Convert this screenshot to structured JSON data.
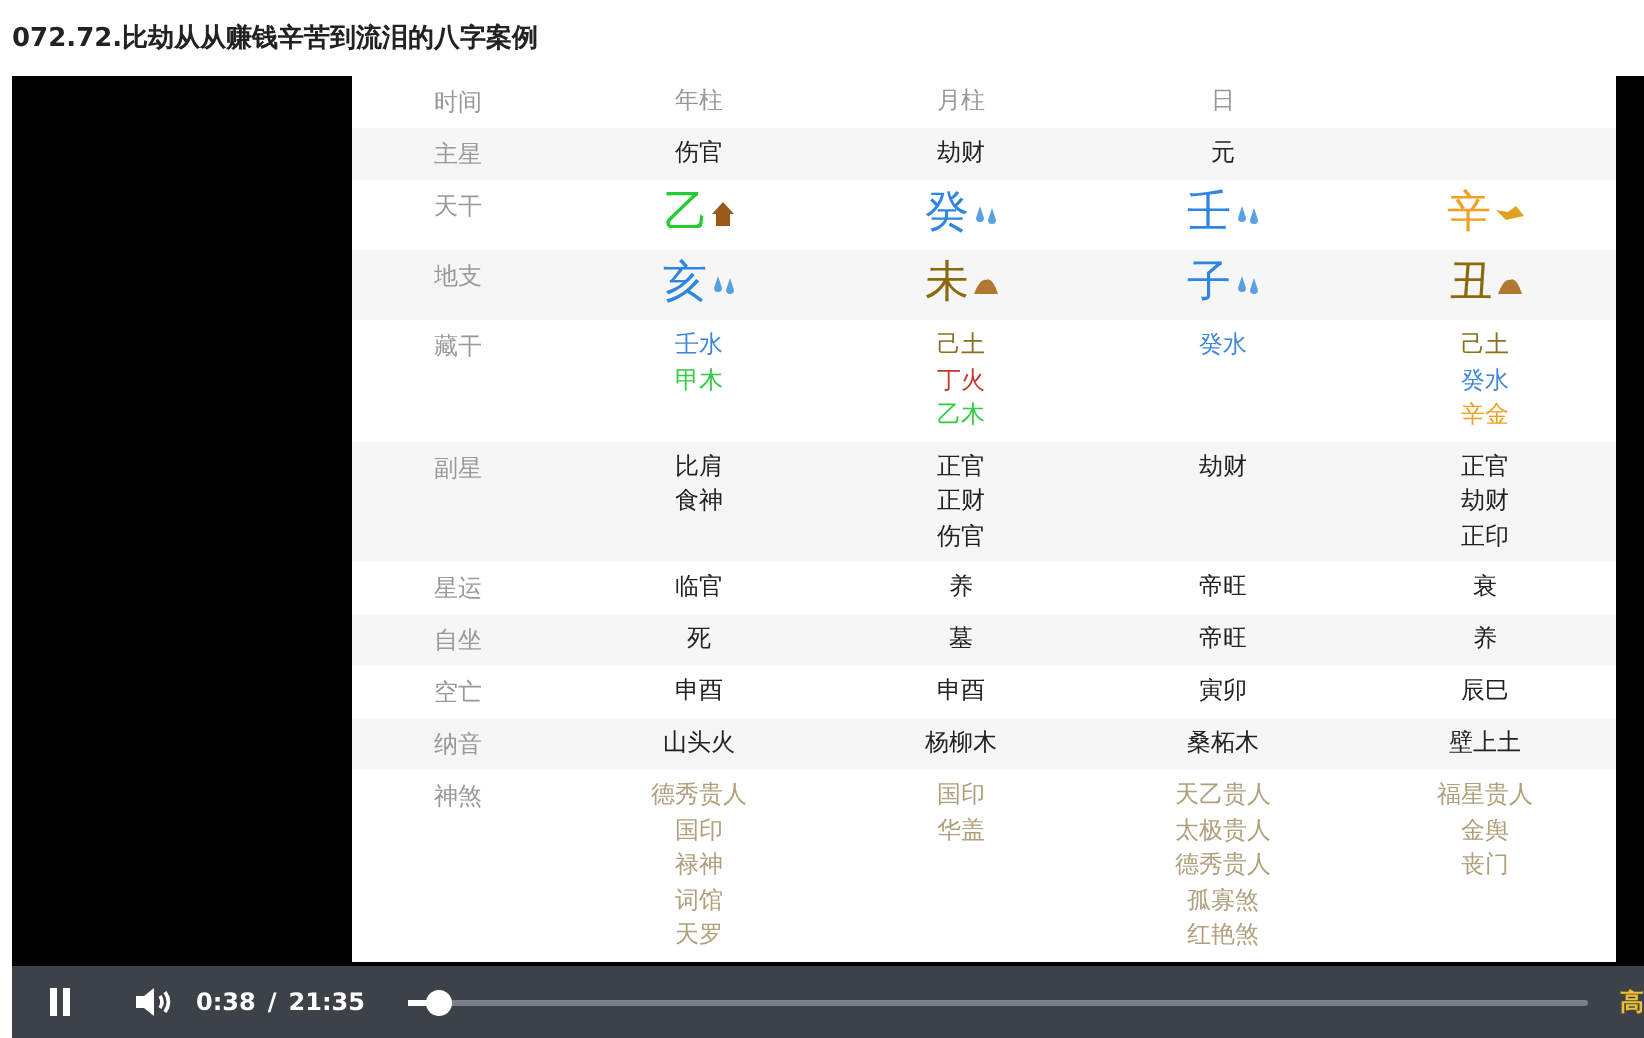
{
  "title": "072.72.比劫从从赚钱辛苦到流泪的八字案例",
  "table": {
    "rows": [
      {
        "label": "时间",
        "kind": "header",
        "cells": [
          [
            {
              "text": "年柱"
            }
          ],
          [
            {
              "text": "月柱"
            }
          ],
          [
            {
              "text": "日"
            }
          ],
          []
        ]
      },
      {
        "label": "主星",
        "kind": "star",
        "cells": [
          [
            {
              "text": "伤官"
            }
          ],
          [
            {
              "text": "劫财"
            }
          ],
          [
            {
              "text": "元"
            }
          ],
          []
        ]
      },
      {
        "label": "天干",
        "kind": "pillar",
        "cells": [
          [
            {
              "text": "乙",
              "color": "#22cc33",
              "kind": "wood"
            }
          ],
          [
            {
              "text": "癸",
              "color": "#2f86e0",
              "kind": "water"
            }
          ],
          [
            {
              "text": "壬",
              "color": "#2f86e0",
              "kind": "water"
            }
          ],
          [
            {
              "text": "辛",
              "color": "#f0a020",
              "kind": "metal"
            }
          ]
        ]
      },
      {
        "label": "地支",
        "kind": "pillar",
        "cells": [
          [
            {
              "text": "亥",
              "color": "#2f86e0",
              "kind": "water"
            }
          ],
          [
            {
              "text": "未",
              "color": "#8a6a10",
              "kind": "earth"
            }
          ],
          [
            {
              "text": "子",
              "color": "#2f86e0",
              "kind": "water"
            }
          ],
          [
            {
              "text": "丑",
              "color": "#8a6a10",
              "kind": "earth"
            }
          ]
        ]
      },
      {
        "label": "藏干",
        "kind": "tone",
        "cells": [
          [
            {
              "text": "壬水",
              "color": "#3f88d8"
            },
            {
              "text": "甲木",
              "color": "#33cc44"
            }
          ],
          [
            {
              "text": "己土",
              "color": "#8a7020"
            },
            {
              "text": "丁火",
              "color": "#c0392b"
            },
            {
              "text": "乙木",
              "color": "#33cc44"
            }
          ],
          [
            {
              "text": "癸水",
              "color": "#3f88d8"
            }
          ],
          [
            {
              "text": "己土",
              "color": "#8a7020"
            },
            {
              "text": "癸水",
              "color": "#3f88d8"
            },
            {
              "text": "辛金",
              "color": "#f0a020"
            }
          ]
        ]
      },
      {
        "label": "副星",
        "kind": "star",
        "cells": [
          [
            {
              "text": "比肩"
            },
            {
              "text": "食神"
            }
          ],
          [
            {
              "text": "正官"
            },
            {
              "text": "正财"
            },
            {
              "text": "伤官"
            }
          ],
          [
            {
              "text": "劫财"
            }
          ],
          [
            {
              "text": "正官"
            },
            {
              "text": "劫财"
            },
            {
              "text": "正印"
            }
          ]
        ]
      },
      {
        "label": "星运",
        "kind": "star",
        "cells": [
          [
            {
              "text": "临官"
            }
          ],
          [
            {
              "text": "养"
            }
          ],
          [
            {
              "text": "帝旺"
            }
          ],
          [
            {
              "text": "衰"
            }
          ]
        ]
      },
      {
        "label": "自坐",
        "kind": "star",
        "cells": [
          [
            {
              "text": "死"
            }
          ],
          [
            {
              "text": "墓"
            }
          ],
          [
            {
              "text": "帝旺"
            }
          ],
          [
            {
              "text": "养"
            }
          ]
        ]
      },
      {
        "label": "空亡",
        "kind": "star",
        "cells": [
          [
            {
              "text": "申酉"
            }
          ],
          [
            {
              "text": "申酉"
            }
          ],
          [
            {
              "text": "寅卯"
            }
          ],
          [
            {
              "text": "辰巳"
            }
          ]
        ]
      },
      {
        "label": "纳音",
        "kind": "star",
        "cells": [
          [
            {
              "text": "山头火"
            }
          ],
          [
            {
              "text": "杨柳木"
            }
          ],
          [
            {
              "text": "桑柘木"
            }
          ],
          [
            {
              "text": "壁上土"
            }
          ]
        ]
      },
      {
        "label": "神煞",
        "kind": "shensha",
        "cells": [
          [
            {
              "text": "德秀贵人"
            },
            {
              "text": "国印"
            },
            {
              "text": "禄神"
            },
            {
              "text": "词馆"
            },
            {
              "text": "天罗"
            }
          ],
          [
            {
              "text": "国印"
            },
            {
              "text": "华盖"
            }
          ],
          [
            {
              "text": "天乙贵人"
            },
            {
              "text": "太极贵人"
            },
            {
              "text": "德秀贵人"
            },
            {
              "text": "孤寡煞"
            },
            {
              "text": "红艳煞"
            }
          ],
          [
            {
              "text": "福星贵人"
            },
            {
              "text": "金舆"
            },
            {
              "text": "丧门"
            }
          ]
        ]
      }
    ]
  },
  "player": {
    "playing": true,
    "current": "0:38",
    "separator": "/",
    "duration": "21:35",
    "level": 0.025,
    "quality": "高"
  }
}
